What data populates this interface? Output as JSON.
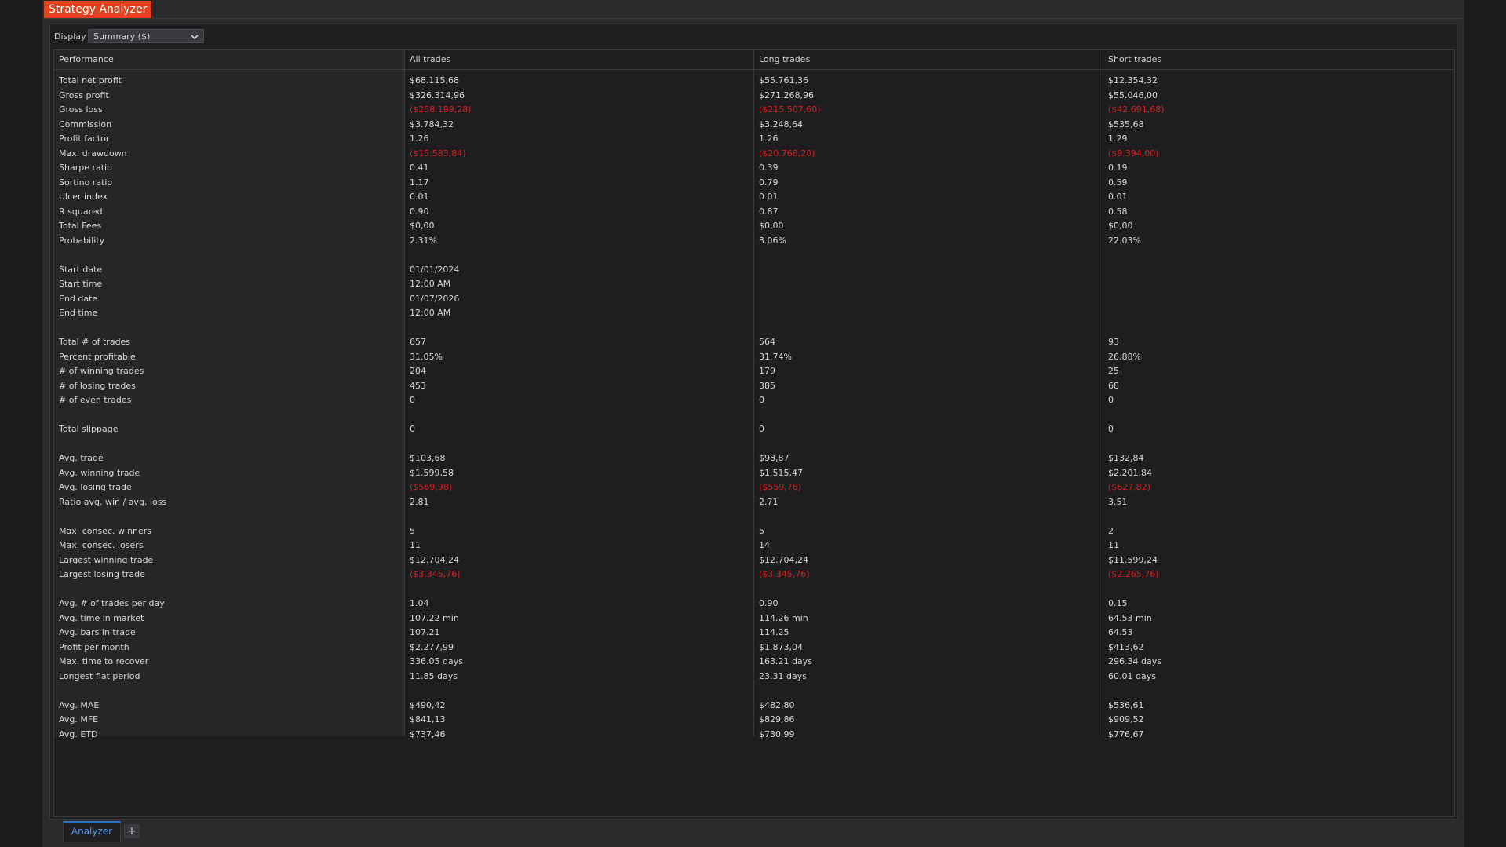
{
  "window": {
    "title": "Strategy Analyzer"
  },
  "toolbar": {
    "display_label": "Display",
    "display_value": "Summary ($)"
  },
  "columns": [
    "Performance",
    "All trades",
    "Long trades",
    "Short trades"
  ],
  "rows": [
    [
      "Total net profit",
      "$68.115,68",
      "$55.761,36",
      "$12.354,32"
    ],
    [
      "Gross profit",
      "$326.314,96",
      "$271.268,96",
      "$55.046,00"
    ],
    [
      "Gross loss",
      "($258.199,28)",
      "($215.507,60)",
      "($42.691,68)"
    ],
    [
      "Commission",
      "$3.784,32",
      "$3.248,64",
      "$535,68"
    ],
    [
      "Profit factor",
      "1.26",
      "1.26",
      "1.29"
    ],
    [
      "Max. drawdown",
      "($15.583,84)",
      "($20.768,20)",
      "($9.394,00)"
    ],
    [
      "Sharpe ratio",
      "0.41",
      "0.39",
      "0.19"
    ],
    [
      "Sortino ratio",
      "1.17",
      "0.79",
      "0.59"
    ],
    [
      "Ulcer index",
      "0.01",
      "0.01",
      "0.01"
    ],
    [
      "R squared",
      "0.90",
      "0.87",
      "0.58"
    ],
    [
      "Total Fees",
      "$0,00",
      "$0,00",
      "$0,00"
    ],
    [
      "Probability",
      "2.31%",
      "3.06%",
      "22.03%"
    ],
    [
      "",
      "",
      "",
      ""
    ],
    [
      "Start date",
      "01/01/2024",
      "",
      ""
    ],
    [
      "Start time",
      "12:00 AM",
      "",
      ""
    ],
    [
      "End date",
      "01/07/2026",
      "",
      ""
    ],
    [
      "End time",
      "12:00 AM",
      "",
      ""
    ],
    [
      "",
      "",
      "",
      ""
    ],
    [
      "Total # of trades",
      "657",
      "564",
      "93"
    ],
    [
      "Percent profitable",
      "31.05%",
      "31.74%",
      "26.88%"
    ],
    [
      "# of winning trades",
      "204",
      "179",
      "25"
    ],
    [
      "# of losing trades",
      "453",
      "385",
      "68"
    ],
    [
      "# of even trades",
      "0",
      "0",
      "0"
    ],
    [
      "",
      "",
      "",
      ""
    ],
    [
      "Total slippage",
      "0",
      "0",
      "0"
    ],
    [
      "",
      "",
      "",
      ""
    ],
    [
      "Avg. trade",
      "$103,68",
      "$98,87",
      "$132,84"
    ],
    [
      "Avg. winning trade",
      "$1.599,58",
      "$1.515,47",
      "$2.201,84"
    ],
    [
      "Avg. losing trade",
      "($569,98)",
      "($559,76)",
      "($627,82)"
    ],
    [
      "Ratio avg. win / avg. loss",
      "2.81",
      "2.71",
      "3.51"
    ],
    [
      "",
      "",
      "",
      ""
    ],
    [
      "Max. consec. winners",
      "5",
      "5",
      "2"
    ],
    [
      "Max. consec. losers",
      "11",
      "14",
      "11"
    ],
    [
      "Largest winning trade",
      "$12.704,24",
      "$12.704,24",
      "$11.599,24"
    ],
    [
      "Largest losing trade",
      "($3.345,76)",
      "($3.345,76)",
      "($2.265,76)"
    ],
    [
      "",
      "",
      "",
      ""
    ],
    [
      "Avg. # of trades per day",
      "1.04",
      "0.90",
      "0.15"
    ],
    [
      "Avg. time in market",
      "107.22 min",
      "114.26 min",
      "64.53 min"
    ],
    [
      "Avg. bars in trade",
      "107.21",
      "114.25",
      "64.53"
    ],
    [
      "Profit per month",
      "$2.277,99",
      "$1.873,04",
      "$413,62"
    ],
    [
      "Max. time to recover",
      "336.05 days",
      "163.21 days",
      "296.34 days"
    ],
    [
      "Longest flat period",
      "11.85 days",
      "23.31 days",
      "60.01 days"
    ],
    [
      "",
      "",
      "",
      ""
    ],
    [
      "Avg. MAE",
      "$490,42",
      "$482,80",
      "$536,61"
    ],
    [
      "Avg. MFE",
      "$841,13",
      "$829,86",
      "$909,52"
    ],
    [
      "Avg. ETD",
      "$737,46",
      "$730,99",
      "$776,67"
    ]
  ],
  "bottom_tabs": {
    "active": "Analyzer",
    "add_label": "+"
  },
  "colors": {
    "accent": "#e2421c",
    "negative": "#d62020",
    "tab_active": "#4f95e6"
  },
  "icons": {
    "dropdown": "chevron-down-icon",
    "add": "plus-icon"
  }
}
